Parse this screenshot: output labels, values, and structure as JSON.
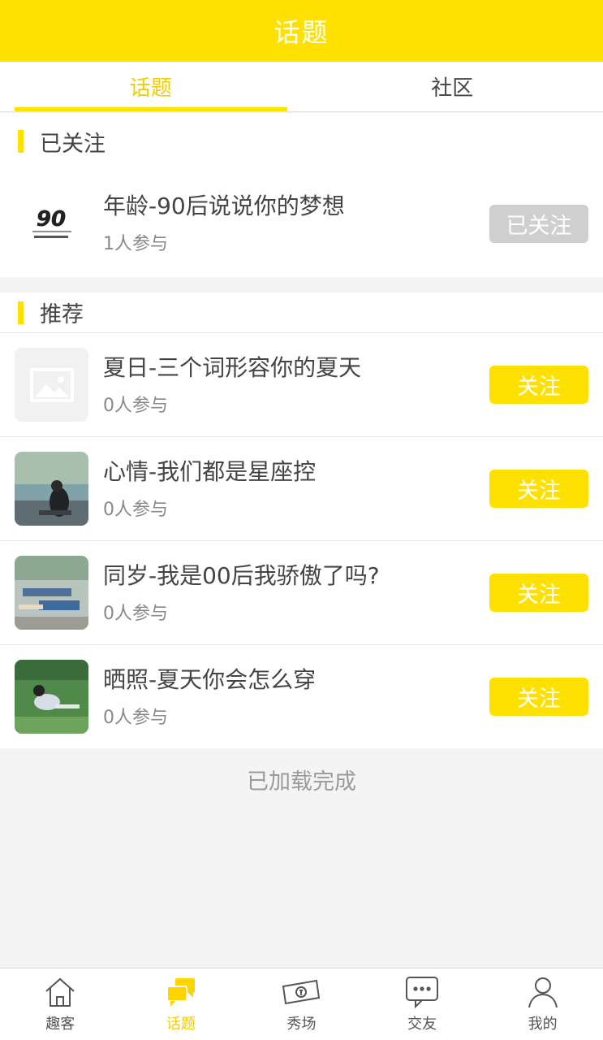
{
  "header": {
    "title": "话题"
  },
  "tabs": [
    {
      "label": "话题",
      "active": true
    },
    {
      "label": "社区",
      "active": false
    }
  ],
  "followed": {
    "heading": "已关注",
    "items": [
      {
        "title": "年龄-90后说说你的梦想",
        "participants": "1人参与",
        "button": "已关注",
        "thumb_icon": "90-logo"
      }
    ]
  },
  "recommended": {
    "heading": "推荐",
    "items": [
      {
        "title": "夏日-三个词形容你的夏天",
        "participants": "0人参与",
        "button": "关注",
        "thumb_icon": "image-placeholder"
      },
      {
        "title": "心情-我们都是星座控",
        "participants": "0人参与",
        "button": "关注",
        "thumb_icon": "photo-seaside"
      },
      {
        "title": "同岁-我是00后我骄傲了吗?",
        "participants": "0人参与",
        "button": "关注",
        "thumb_icon": "photo-classroom"
      },
      {
        "title": "晒照-夏天你会怎么穿",
        "participants": "0人参与",
        "button": "关注",
        "thumb_icon": "photo-grass"
      }
    ]
  },
  "footer_status": "已加载完成",
  "bottom_nav": [
    {
      "label": "趣客",
      "icon": "home-icon",
      "active": false
    },
    {
      "label": "话题",
      "icon": "chat-bubbles-icon",
      "active": true
    },
    {
      "label": "秀场",
      "icon": "money-icon",
      "active": false
    },
    {
      "label": "交友",
      "icon": "message-icon",
      "active": false
    },
    {
      "label": "我的",
      "icon": "person-icon",
      "active": false
    }
  ],
  "colors": {
    "accent": "#ffe100",
    "accent_text": "#f5cc00",
    "followed_button": "#cfcfcf",
    "background": "#f4f4f4"
  }
}
